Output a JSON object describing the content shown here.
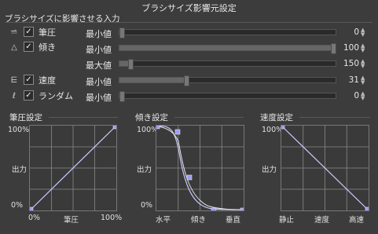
{
  "window_title": "ブラシサイズ影響元設定",
  "section_title": "ブラシサイズに影響させる入力",
  "rows": [
    {
      "icon": "⥬",
      "checked": "✓",
      "label": "筆圧",
      "params": [
        {
          "name": "最小値",
          "value": "0",
          "level": 0.0
        }
      ]
    },
    {
      "icon": "△",
      "checked": "✓",
      "label": "傾き",
      "params": [
        {
          "name": "最小値",
          "value": "100",
          "level": 1.0
        },
        {
          "name": "最大値",
          "value": "150",
          "level": 0.05
        }
      ]
    },
    {
      "icon": "⋿",
      "checked": "✓",
      "label": "速度",
      "params": [
        {
          "name": "最小値",
          "value": "31",
          "level": 0.31
        }
      ]
    },
    {
      "icon": "ℓ",
      "checked": "✓",
      "label": "ランダム",
      "params": [
        {
          "name": "最小値",
          "value": "0",
          "level": 0.0
        }
      ]
    }
  ],
  "spin_up": "▲",
  "spin_down": "▼",
  "graphs": [
    {
      "title": "筆圧設定",
      "y_top": "100%",
      "y_mid": "出力",
      "y_bottom": "0%",
      "x_left": "0%",
      "x_mid": "筆圧",
      "x_right": "100%"
    },
    {
      "title": "傾き設定",
      "y_top": "100%",
      "y_mid": "出力",
      "y_bottom": "0%",
      "x_left": "水平",
      "x_mid": "傾き",
      "x_right": "垂直"
    },
    {
      "title": "速度設定",
      "y_top": "100%",
      "y_mid": "出力",
      "y_bottom": "",
      "x_left": "静止",
      "x_mid": "速度",
      "x_right": "高速"
    }
  ],
  "colors": {
    "curve": "#c8c8ff",
    "point": "#9d9df0",
    "grid": "#8a8a8a"
  }
}
